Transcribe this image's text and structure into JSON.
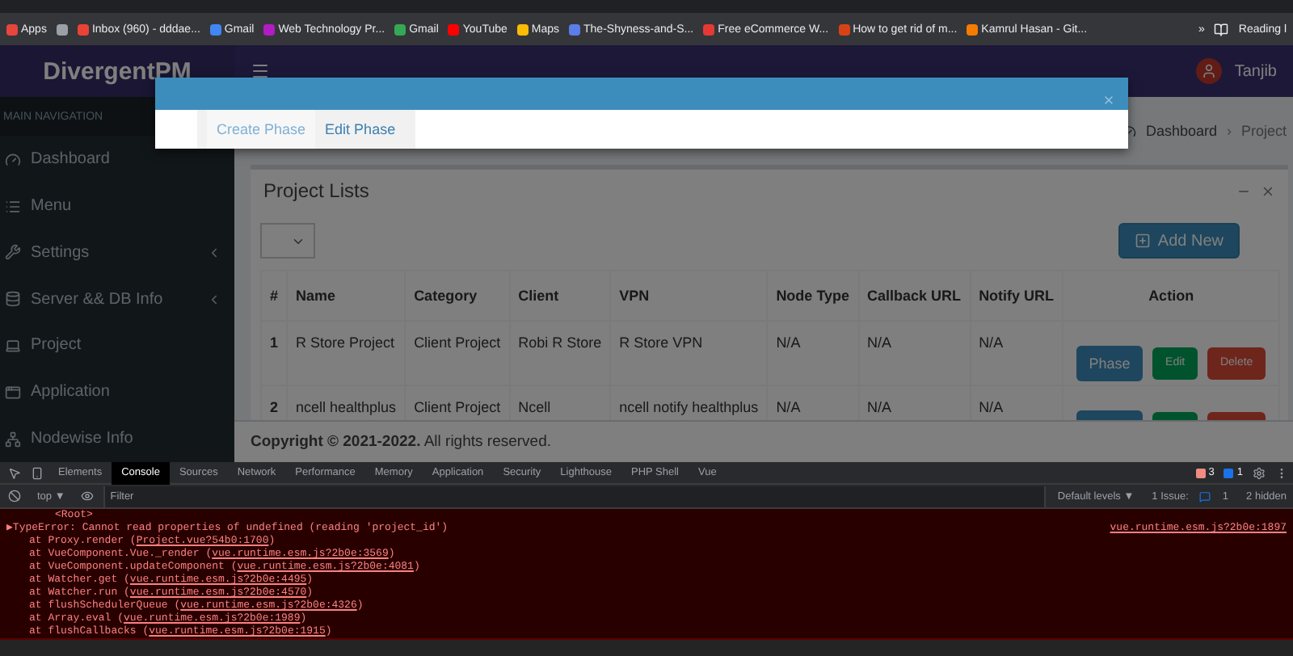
{
  "bookmarks": [
    {
      "label": "Apps",
      "color": "#e8453c"
    },
    {
      "color": "#9aa0a6"
    },
    {
      "label": "Inbox (960) - dddae...",
      "color": "#ea4335"
    },
    {
      "label": "Gmail",
      "color": "#4285f4"
    },
    {
      "label": "Web Technology Pr...",
      "color": "#b21cc2"
    },
    {
      "label": "Gmail",
      "color": "#34a853"
    },
    {
      "label": "YouTube",
      "color": "#ff0000"
    },
    {
      "label": "Maps",
      "color": "#fbbc05"
    },
    {
      "label": "The-Shyness-and-S...",
      "color": "#5b7de8"
    },
    {
      "label": "Free eCommerce W...",
      "color": "#e53935"
    },
    {
      "label": "How to get rid of m...",
      "color": "#d84315"
    },
    {
      "label": "Kamrul Hasan - Git...",
      "color": "#f57c00"
    }
  ],
  "bookmarks_more": "»",
  "reading_list": "Reading l",
  "app": {
    "brand": "**Divergent**PM",
    "user": "Tanjib",
    "nav_header": "MAIN NAVIGATION",
    "nav": [
      {
        "label": "Dashboard",
        "kind": "dashboard",
        "submenu": false
      },
      {
        "label": "Menu",
        "kind": "menu",
        "submenu": false
      },
      {
        "label": "Settings",
        "kind": "settings",
        "submenu": true
      },
      {
        "label": "Server && DB Info",
        "kind": "server",
        "submenu": true
      },
      {
        "label": "Project",
        "kind": "project",
        "submenu": false
      },
      {
        "label": "Application",
        "kind": "application",
        "submenu": false
      },
      {
        "label": "Nodewise Info",
        "kind": "nodewise",
        "submenu": false
      }
    ],
    "breadcrumb": [
      "Dashboard",
      "Project"
    ],
    "breadcrumb_separator": "›",
    "box_title": "Project Lists",
    "add_button": "Add New",
    "table": {
      "columns": [
        "#",
        "Name",
        "Category",
        "Client",
        "VPN",
        "Node Type",
        "Callback URL",
        "Notify URL",
        "Action"
      ],
      "rows": [
        {
          "cells": [
            "1",
            "R Store Project",
            "Client Project",
            "Robi R Store",
            "R Store VPN",
            "N/A",
            "N/A",
            "N/A"
          ],
          "actions": [
            {
              "kind": "phase",
              "label": "Phase"
            },
            {
              "kind": "edit",
              "label": "Edit"
            },
            {
              "kind": "delete",
              "label": "Delete"
            }
          ]
        },
        {
          "cells": [
            "2",
            "ncell healthplus",
            "Client Project",
            "Ncell",
            "ncell notify healthplus",
            "N/A",
            "N/A",
            "N/A"
          ],
          "actions": [
            {
              "kind": "phase"
            },
            {
              "kind": "edit"
            },
            {
              "kind": "delete"
            }
          ]
        }
      ]
    },
    "footer": "**Copyright © 2021-2022.** All rights reserved."
  },
  "modal": {
    "tabs": [
      {
        "label": "Create Phase",
        "selected": true
      },
      {
        "label": "Edit Phase",
        "selected": false
      }
    ]
  },
  "devtools": {
    "tabs": [
      {
        "label": "Elements",
        "selected": false
      },
      {
        "label": "Console",
        "selected": true
      },
      {
        "label": "Sources",
        "selected": false
      },
      {
        "label": "Network",
        "selected": false
      },
      {
        "label": "Performance",
        "selected": false
      },
      {
        "label": "Memory",
        "selected": false
      },
      {
        "label": "Application",
        "selected": false
      },
      {
        "label": "Security",
        "selected": false
      },
      {
        "label": "Lighthouse",
        "selected": false
      },
      {
        "label": "PHP Shell",
        "selected": false
      },
      {
        "label": "Vue",
        "selected": false
      }
    ],
    "error_count": "3",
    "message_count": "1",
    "context": "top ▼",
    "filter_placeholder": "Filter",
    "levels": "Default levels ▼",
    "issues": "1 Issue:",
    "issues_count": "1",
    "hidden": "2 hidden",
    "console": {
      "root": "<Root>",
      "error": "▶TypeError: Cannot read properties of undefined (reading 'project_id')",
      "error_source": "vue.runtime.esm.js?2b0e:1897",
      "stack": [
        {
          "text": "at Proxy.render (",
          "link": "Project.vue?54b0:1700",
          "tail": ")"
        },
        {
          "text": "at VueComponent.Vue._render (",
          "link": "vue.runtime.esm.js?2b0e:3569",
          "tail": ")"
        },
        {
          "text": "at VueComponent.updateComponent (",
          "link": "vue.runtime.esm.js?2b0e:4081",
          "tail": ")"
        },
        {
          "text": "at Watcher.get (",
          "link": "vue.runtime.esm.js?2b0e:4495",
          "tail": ")"
        },
        {
          "text": "at Watcher.run (",
          "link": "vue.runtime.esm.js?2b0e:4570",
          "tail": ")"
        },
        {
          "text": "at flushSchedulerQueue (",
          "link": "vue.runtime.esm.js?2b0e:4326",
          "tail": ")"
        },
        {
          "text": "at Array.eval (",
          "link": "vue.runtime.esm.js?2b0e:1989",
          "tail": ")"
        },
        {
          "text": "at flushCallbacks (",
          "link": "vue.runtime.esm.js?2b0e:1915",
          "tail": ")"
        }
      ]
    }
  }
}
